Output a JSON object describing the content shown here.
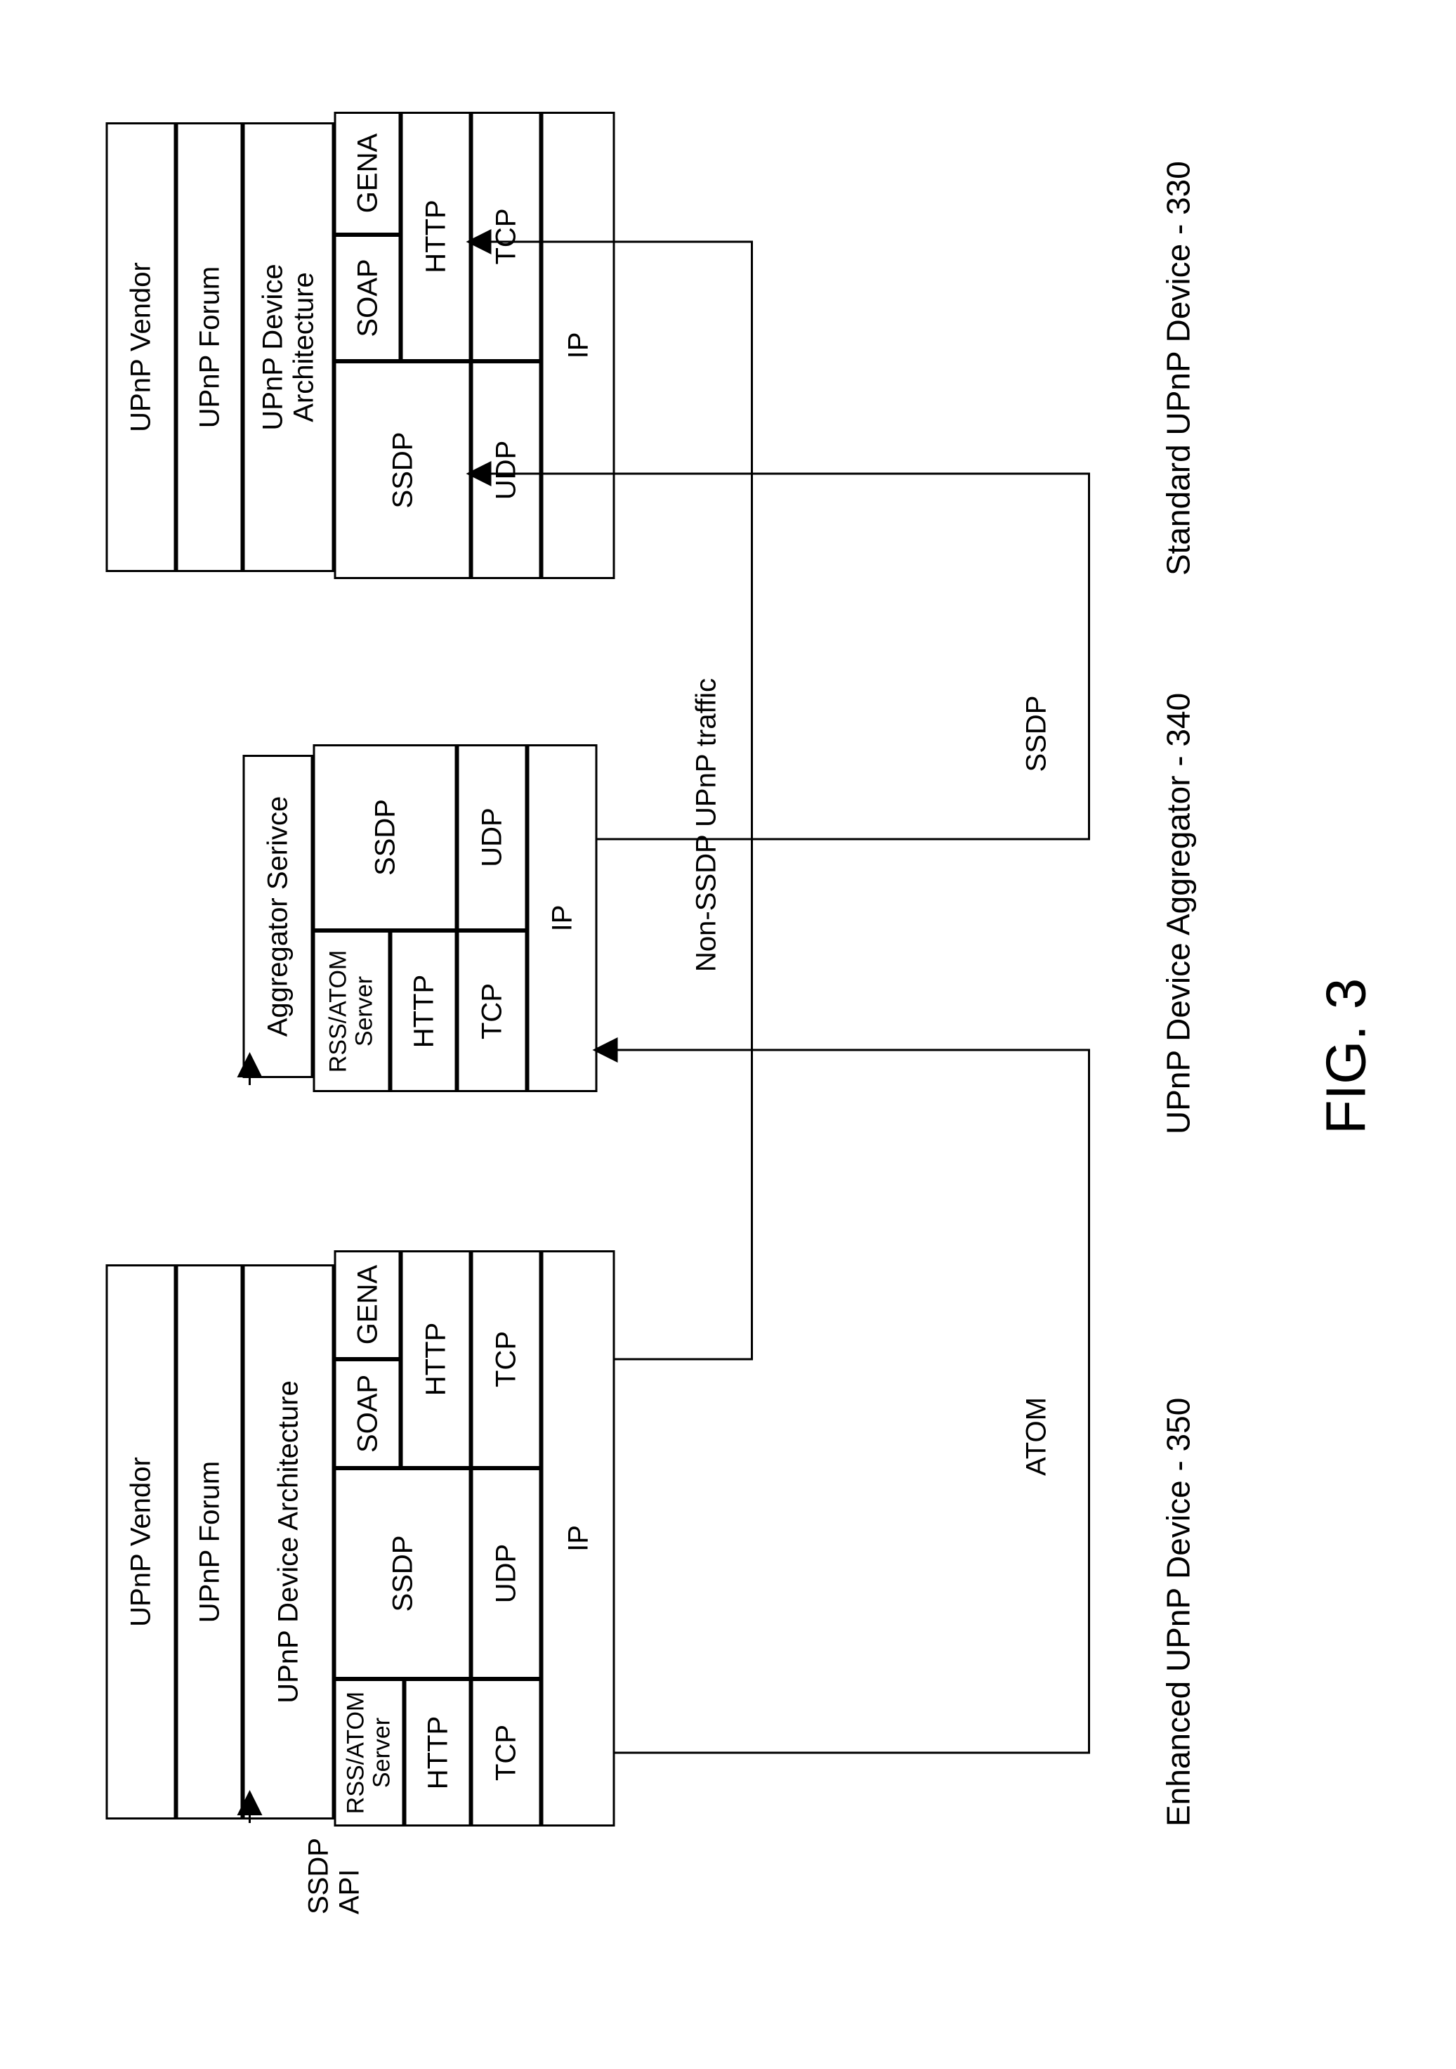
{
  "figure_label": "FIG. 3",
  "left_stack": {
    "ssdp_api": "SSDP\nAPI",
    "vendor": "UPnP Vendor",
    "forum": "UPnP Forum",
    "arch": "UPnP Device Architecture",
    "rss": "RSS/ATOM\nServer",
    "ssdp": "SSDP",
    "soap": "SOAP",
    "gena": "GENA",
    "http_l": "HTTP",
    "http_r": "HTTP",
    "tcp_l": "TCP",
    "udp": "UDP",
    "tcp_r": "TCP",
    "ip": "IP",
    "caption": "Enhanced UPnP Device - 350"
  },
  "middle_stack": {
    "agg": "Aggregator Serivce",
    "rss": "RSS/ATOM\nServer",
    "ssdp": "SSDP",
    "http": "HTTP",
    "tcp": "TCP",
    "udp": "UDP",
    "ip": "IP",
    "caption": "UPnP Device Aggregator - 340"
  },
  "right_stack": {
    "vendor": "UPnP Vendor",
    "forum": "UPnP Forum",
    "arch": "UPnP Device\nArchitecture",
    "ssdp": "SSDP",
    "soap": "SOAP",
    "gena": "GENA",
    "http": "HTTP",
    "udp": "UDP",
    "tcp": "TCP",
    "ip": "IP",
    "caption": "Standard UPnP Device - 330"
  },
  "links": {
    "atom": "ATOM",
    "non_ssdp": "Non-SSDP UPnP traffic",
    "ssdp": "SSDP"
  }
}
